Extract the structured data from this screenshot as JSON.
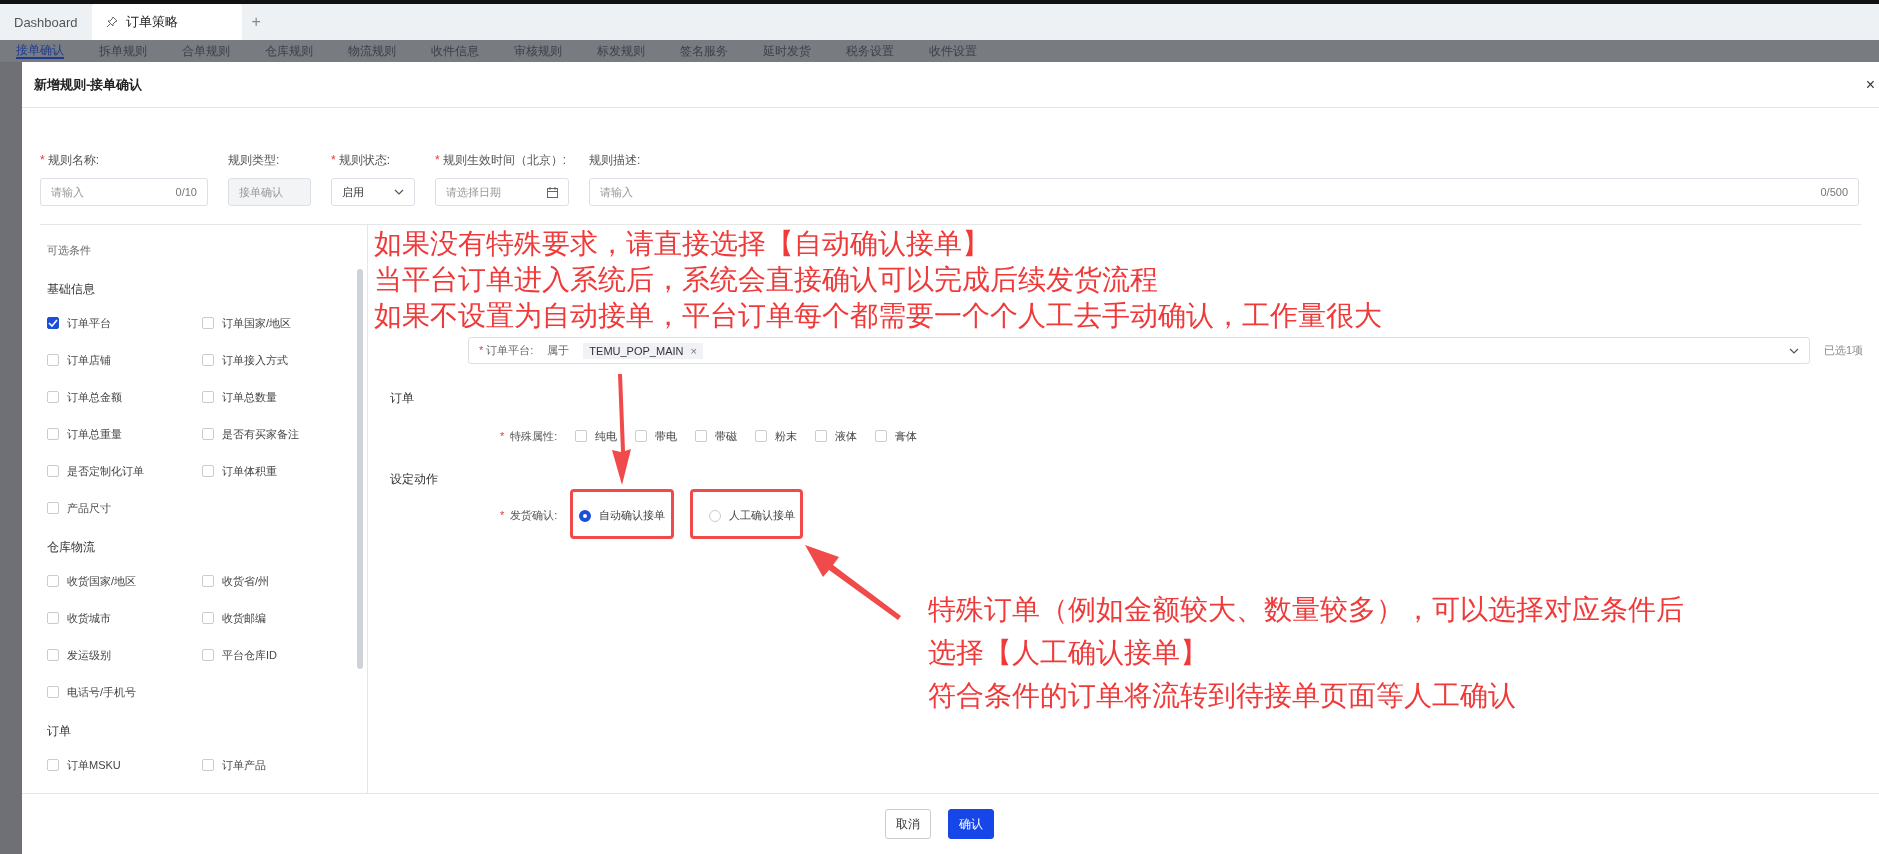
{
  "top_tabs": [
    {
      "label": "Dashboard",
      "selected": false,
      "pinned": false
    },
    {
      "label": "订单策略",
      "selected": true,
      "pinned": true
    }
  ],
  "add_tab": "+",
  "rule_tabs": [
    {
      "label": "接单确认",
      "selected": true
    },
    {
      "label": "拆单规则",
      "selected": false
    },
    {
      "label": "合单规则",
      "selected": false
    },
    {
      "label": "仓库规则",
      "selected": false
    },
    {
      "label": "物流规则",
      "selected": false
    },
    {
      "label": "收件信息",
      "selected": false
    },
    {
      "label": "审核规则",
      "selected": false
    },
    {
      "label": "标发规则",
      "selected": false
    },
    {
      "label": "签名服务",
      "selected": false
    },
    {
      "label": "延时发货",
      "selected": false
    },
    {
      "label": "税务设置",
      "selected": false
    },
    {
      "label": "收件设置",
      "selected": false
    }
  ],
  "modal": {
    "title": "新增规则-接单确认",
    "close": "×"
  },
  "form_fields": [
    {
      "kind": "input",
      "mark": "*",
      "label": "规则名称:",
      "placeholder": "请输入",
      "counter": "0/10"
    },
    {
      "kind": "readonly",
      "label": "规则类型:",
      "value": "接单确认"
    },
    {
      "kind": "select",
      "mark": "*",
      "label": "规则状态:",
      "value": "启用"
    },
    {
      "kind": "date",
      "mark": "*",
      "label": "规则生效时间（北京）:",
      "placeholder": "请选择日期"
    },
    {
      "kind": "wide",
      "label": "规则描述:",
      "placeholder": "请输入",
      "counter": "0/500"
    }
  ],
  "condition_panel": {
    "title": "可选条件",
    "groups": [
      {
        "title": "基础信息",
        "items": [
          {
            "label": "订单平台",
            "checked": true
          },
          {
            "label": "订单国家/地区",
            "checked": false
          },
          {
            "label": "订单店铺",
            "checked": false
          },
          {
            "label": "订单接入方式",
            "checked": false
          },
          {
            "label": "订单总金额",
            "checked": false
          },
          {
            "label": "订单总数量",
            "checked": false
          },
          {
            "label": "订单总重量",
            "checked": false
          },
          {
            "label": "是否有买家备注",
            "checked": false
          },
          {
            "label": "是否定制化订单",
            "checked": false
          },
          {
            "label": "订单体积重",
            "checked": false
          },
          {
            "label": "产品尺寸",
            "checked": false
          }
        ]
      },
      {
        "title": "仓库物流",
        "items": [
          {
            "label": "收货国家/地区",
            "checked": false
          },
          {
            "label": "收货省/州",
            "checked": false
          },
          {
            "label": "收货城市",
            "checked": false
          },
          {
            "label": "收货邮编",
            "checked": false
          },
          {
            "label": "发运级别",
            "checked": false
          },
          {
            "label": "平台仓库ID",
            "checked": false
          },
          {
            "label": "电话号/手机号",
            "checked": false
          }
        ]
      },
      {
        "title": "订单",
        "items": [
          {
            "label": "订单MSKU",
            "checked": false
          },
          {
            "label": "订单产品",
            "checked": false
          }
        ]
      }
    ]
  },
  "selected_panel": {
    "condition": {
      "mark": "*",
      "label": "订单平台:",
      "operator": "属于",
      "tags": [
        {
          "label": "TEMU_POP_MAIN",
          "remove": "×"
        }
      ],
      "count": "已选1项"
    },
    "order_section": {
      "title": "订单",
      "mark": "*",
      "label": "特殊属性:",
      "options": [
        {
          "label": "纯电",
          "checked": false
        },
        {
          "label": "带电",
          "checked": false
        },
        {
          "label": "带磁",
          "checked": false
        },
        {
          "label": "粉末",
          "checked": false
        },
        {
          "label": "液体",
          "checked": false
        },
        {
          "label": "膏体",
          "checked": false
        }
      ]
    },
    "action_section": {
      "title": "设定动作",
      "mark": "*",
      "label": "发货确认:",
      "options": [
        {
          "label": "自动确认接单",
          "selected": true
        },
        {
          "label": "人工确认接单",
          "selected": false
        }
      ]
    }
  },
  "footer": {
    "buttons": [
      {
        "label": "取消",
        "kind": "secondary"
      },
      {
        "label": "确认",
        "kind": "primary"
      }
    ]
  },
  "annotations": {
    "top_note": [
      "如果没有特殊要求，请直接选择【自动确认接单】",
      "当平台订单进入系统后，系统会直接确认可以完成后续发货流程",
      "如果不设置为自动接单，平台订单每个都需要一个个人工去手动确认，工作量很大"
    ],
    "bottom_note": [
      "特殊订单（例如金额较大、数量较多），可以选择对应条件后",
      "选择【人工确认接单】",
      "符合条件的订单将流转到待接单页面等人工确认"
    ]
  }
}
